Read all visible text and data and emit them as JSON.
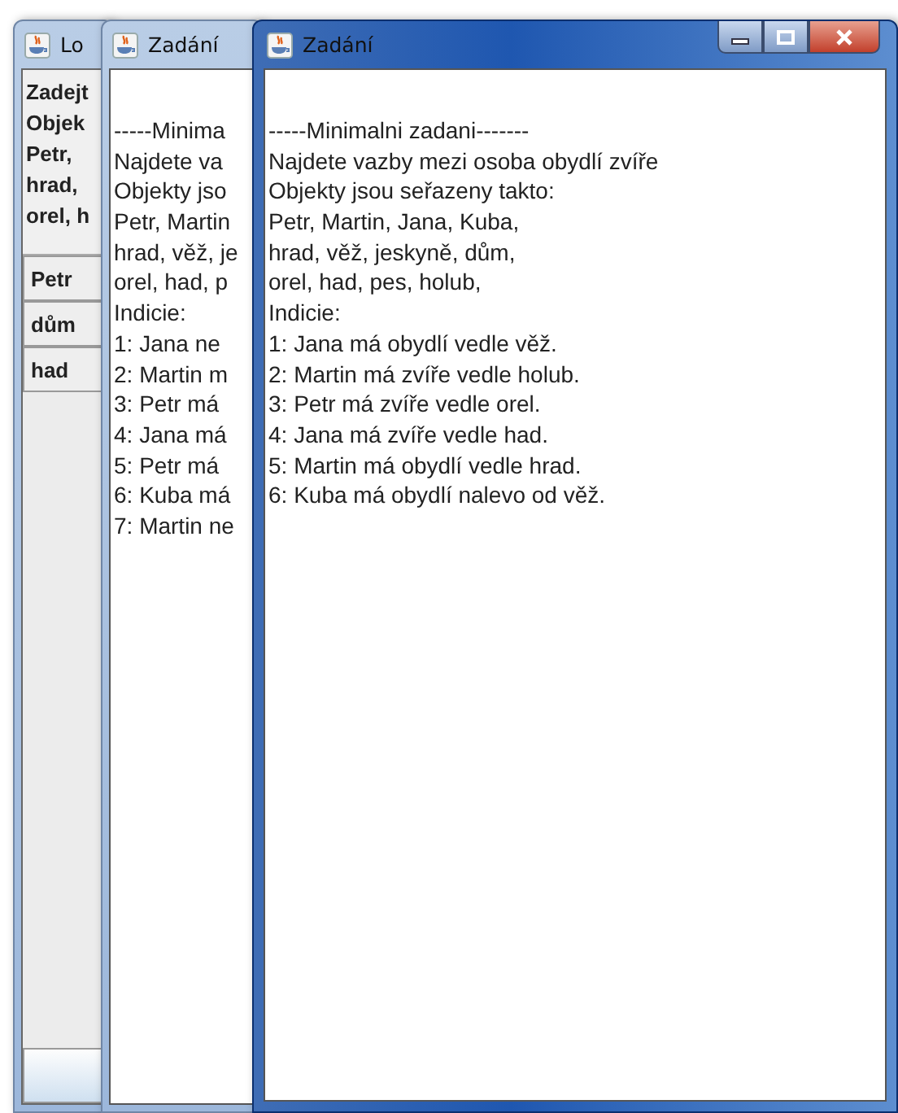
{
  "windows": [
    {
      "title": "Lo",
      "active": false,
      "kind": "input",
      "text_lines": [
        "Zadejt",
        "Objek",
        "Petr,",
        "hrad,",
        "orel, h"
      ],
      "buttons": [
        "Petr",
        "dům",
        "had"
      ]
    },
    {
      "title": "Zadání",
      "active": false,
      "kind": "text",
      "text_lines": [
        "-----Minima",
        "Najdete va",
        "Objekty jso",
        "Petr, Martin",
        "hrad, věž, je",
        "orel, had, p",
        "Indicie:",
        "1: Jana ne",
        "2: Martin m",
        "3: Petr má",
        "4: Jana má",
        "5: Petr má",
        "6: Kuba má",
        "7: Martin ne"
      ]
    },
    {
      "title": "Zadání",
      "active": true,
      "kind": "text",
      "text_lines": [
        "-----Minimalni zadani-------",
        "Najdete vazby mezi osoba obydlí zvíře",
        "Objekty jsou seřazeny takto:",
        "Petr, Martin, Jana, Kuba,",
        "hrad, věž, jeskyně, dům,",
        "orel, had, pes, holub,",
        "Indicie:",
        "1: Jana má obydlí vedle věž.",
        "2: Martin má zvíře vedle holub.",
        "3: Petr má zvíře vedle orel.",
        "4: Jana má zvíře vedle had.",
        "5: Martin má obydlí vedle hrad.",
        "6: Kuba má obydlí nalevo od věž."
      ]
    }
  ]
}
